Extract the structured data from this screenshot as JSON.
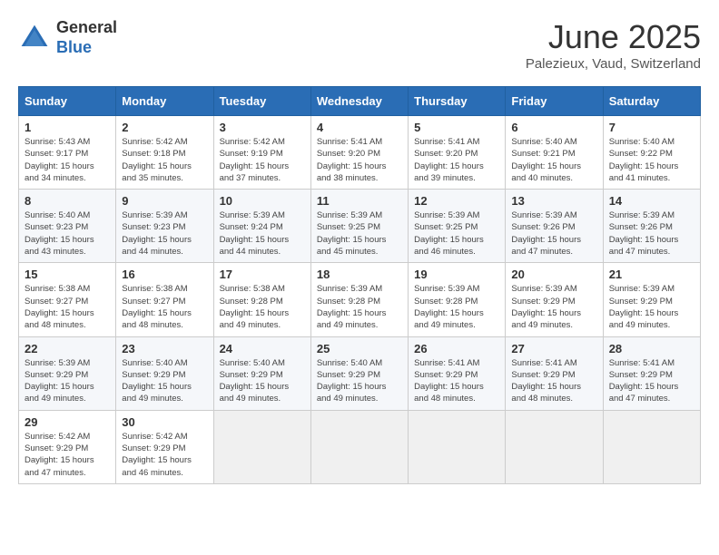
{
  "header": {
    "logo_general": "General",
    "logo_blue": "Blue",
    "month_title": "June 2025",
    "location": "Palezieux, Vaud, Switzerland"
  },
  "days_of_week": [
    "Sunday",
    "Monday",
    "Tuesday",
    "Wednesday",
    "Thursday",
    "Friday",
    "Saturday"
  ],
  "weeks": [
    [
      {
        "day": "1",
        "sunrise": "Sunrise: 5:43 AM",
        "sunset": "Sunset: 9:17 PM",
        "daylight": "Daylight: 15 hours and 34 minutes."
      },
      {
        "day": "2",
        "sunrise": "Sunrise: 5:42 AM",
        "sunset": "Sunset: 9:18 PM",
        "daylight": "Daylight: 15 hours and 35 minutes."
      },
      {
        "day": "3",
        "sunrise": "Sunrise: 5:42 AM",
        "sunset": "Sunset: 9:19 PM",
        "daylight": "Daylight: 15 hours and 37 minutes."
      },
      {
        "day": "4",
        "sunrise": "Sunrise: 5:41 AM",
        "sunset": "Sunset: 9:20 PM",
        "daylight": "Daylight: 15 hours and 38 minutes."
      },
      {
        "day": "5",
        "sunrise": "Sunrise: 5:41 AM",
        "sunset": "Sunset: 9:20 PM",
        "daylight": "Daylight: 15 hours and 39 minutes."
      },
      {
        "day": "6",
        "sunrise": "Sunrise: 5:40 AM",
        "sunset": "Sunset: 9:21 PM",
        "daylight": "Daylight: 15 hours and 40 minutes."
      },
      {
        "day": "7",
        "sunrise": "Sunrise: 5:40 AM",
        "sunset": "Sunset: 9:22 PM",
        "daylight": "Daylight: 15 hours and 41 minutes."
      }
    ],
    [
      {
        "day": "8",
        "sunrise": "Sunrise: 5:40 AM",
        "sunset": "Sunset: 9:23 PM",
        "daylight": "Daylight: 15 hours and 43 minutes."
      },
      {
        "day": "9",
        "sunrise": "Sunrise: 5:39 AM",
        "sunset": "Sunset: 9:23 PM",
        "daylight": "Daylight: 15 hours and 44 minutes."
      },
      {
        "day": "10",
        "sunrise": "Sunrise: 5:39 AM",
        "sunset": "Sunset: 9:24 PM",
        "daylight": "Daylight: 15 hours and 44 minutes."
      },
      {
        "day": "11",
        "sunrise": "Sunrise: 5:39 AM",
        "sunset": "Sunset: 9:25 PM",
        "daylight": "Daylight: 15 hours and 45 minutes."
      },
      {
        "day": "12",
        "sunrise": "Sunrise: 5:39 AM",
        "sunset": "Sunset: 9:25 PM",
        "daylight": "Daylight: 15 hours and 46 minutes."
      },
      {
        "day": "13",
        "sunrise": "Sunrise: 5:39 AM",
        "sunset": "Sunset: 9:26 PM",
        "daylight": "Daylight: 15 hours and 47 minutes."
      },
      {
        "day": "14",
        "sunrise": "Sunrise: 5:39 AM",
        "sunset": "Sunset: 9:26 PM",
        "daylight": "Daylight: 15 hours and 47 minutes."
      }
    ],
    [
      {
        "day": "15",
        "sunrise": "Sunrise: 5:38 AM",
        "sunset": "Sunset: 9:27 PM",
        "daylight": "Daylight: 15 hours and 48 minutes."
      },
      {
        "day": "16",
        "sunrise": "Sunrise: 5:38 AM",
        "sunset": "Sunset: 9:27 PM",
        "daylight": "Daylight: 15 hours and 48 minutes."
      },
      {
        "day": "17",
        "sunrise": "Sunrise: 5:38 AM",
        "sunset": "Sunset: 9:28 PM",
        "daylight": "Daylight: 15 hours and 49 minutes."
      },
      {
        "day": "18",
        "sunrise": "Sunrise: 5:39 AM",
        "sunset": "Sunset: 9:28 PM",
        "daylight": "Daylight: 15 hours and 49 minutes."
      },
      {
        "day": "19",
        "sunrise": "Sunrise: 5:39 AM",
        "sunset": "Sunset: 9:28 PM",
        "daylight": "Daylight: 15 hours and 49 minutes."
      },
      {
        "day": "20",
        "sunrise": "Sunrise: 5:39 AM",
        "sunset": "Sunset: 9:29 PM",
        "daylight": "Daylight: 15 hours and 49 minutes."
      },
      {
        "day": "21",
        "sunrise": "Sunrise: 5:39 AM",
        "sunset": "Sunset: 9:29 PM",
        "daylight": "Daylight: 15 hours and 49 minutes."
      }
    ],
    [
      {
        "day": "22",
        "sunrise": "Sunrise: 5:39 AM",
        "sunset": "Sunset: 9:29 PM",
        "daylight": "Daylight: 15 hours and 49 minutes."
      },
      {
        "day": "23",
        "sunrise": "Sunrise: 5:40 AM",
        "sunset": "Sunset: 9:29 PM",
        "daylight": "Daylight: 15 hours and 49 minutes."
      },
      {
        "day": "24",
        "sunrise": "Sunrise: 5:40 AM",
        "sunset": "Sunset: 9:29 PM",
        "daylight": "Daylight: 15 hours and 49 minutes."
      },
      {
        "day": "25",
        "sunrise": "Sunrise: 5:40 AM",
        "sunset": "Sunset: 9:29 PM",
        "daylight": "Daylight: 15 hours and 49 minutes."
      },
      {
        "day": "26",
        "sunrise": "Sunrise: 5:41 AM",
        "sunset": "Sunset: 9:29 PM",
        "daylight": "Daylight: 15 hours and 48 minutes."
      },
      {
        "day": "27",
        "sunrise": "Sunrise: 5:41 AM",
        "sunset": "Sunset: 9:29 PM",
        "daylight": "Daylight: 15 hours and 48 minutes."
      },
      {
        "day": "28",
        "sunrise": "Sunrise: 5:41 AM",
        "sunset": "Sunset: 9:29 PM",
        "daylight": "Daylight: 15 hours and 47 minutes."
      }
    ],
    [
      {
        "day": "29",
        "sunrise": "Sunrise: 5:42 AM",
        "sunset": "Sunset: 9:29 PM",
        "daylight": "Daylight: 15 hours and 47 minutes."
      },
      {
        "day": "30",
        "sunrise": "Sunrise: 5:42 AM",
        "sunset": "Sunset: 9:29 PM",
        "daylight": "Daylight: 15 hours and 46 minutes."
      },
      null,
      null,
      null,
      null,
      null
    ]
  ]
}
